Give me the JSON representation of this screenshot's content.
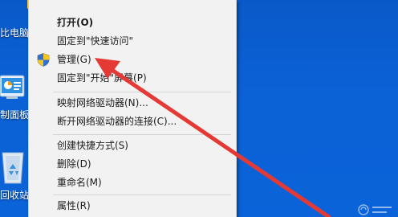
{
  "desktop": {
    "icons": [
      {
        "label": "比电脑",
        "icon": "computer-icon"
      },
      {
        "label": "制面板",
        "icon": "control-panel-icon"
      },
      {
        "label": "回收站",
        "icon": "recycle-bin-icon"
      }
    ]
  },
  "context_menu": {
    "items": [
      {
        "label": "打开(O)",
        "bold": true
      },
      {
        "label": "固定到\"快速访问\""
      },
      {
        "label": "管理(G)",
        "icon": "uac-shield-icon"
      },
      {
        "label": "固定到\"开始\"屏幕(P)"
      },
      {
        "label": "映射网络驱动器(N)..."
      },
      {
        "label": "断开网络驱动器的连接(C)..."
      },
      {
        "label": "创建快捷方式(S)"
      },
      {
        "label": "删除(D)"
      },
      {
        "label": "重命名(M)"
      },
      {
        "label": "属性(R)"
      }
    ]
  },
  "colors": {
    "desktop_blue": "#0b62d6",
    "menu_bg": "#f2f2f2",
    "arrow_red": "#e53935"
  }
}
